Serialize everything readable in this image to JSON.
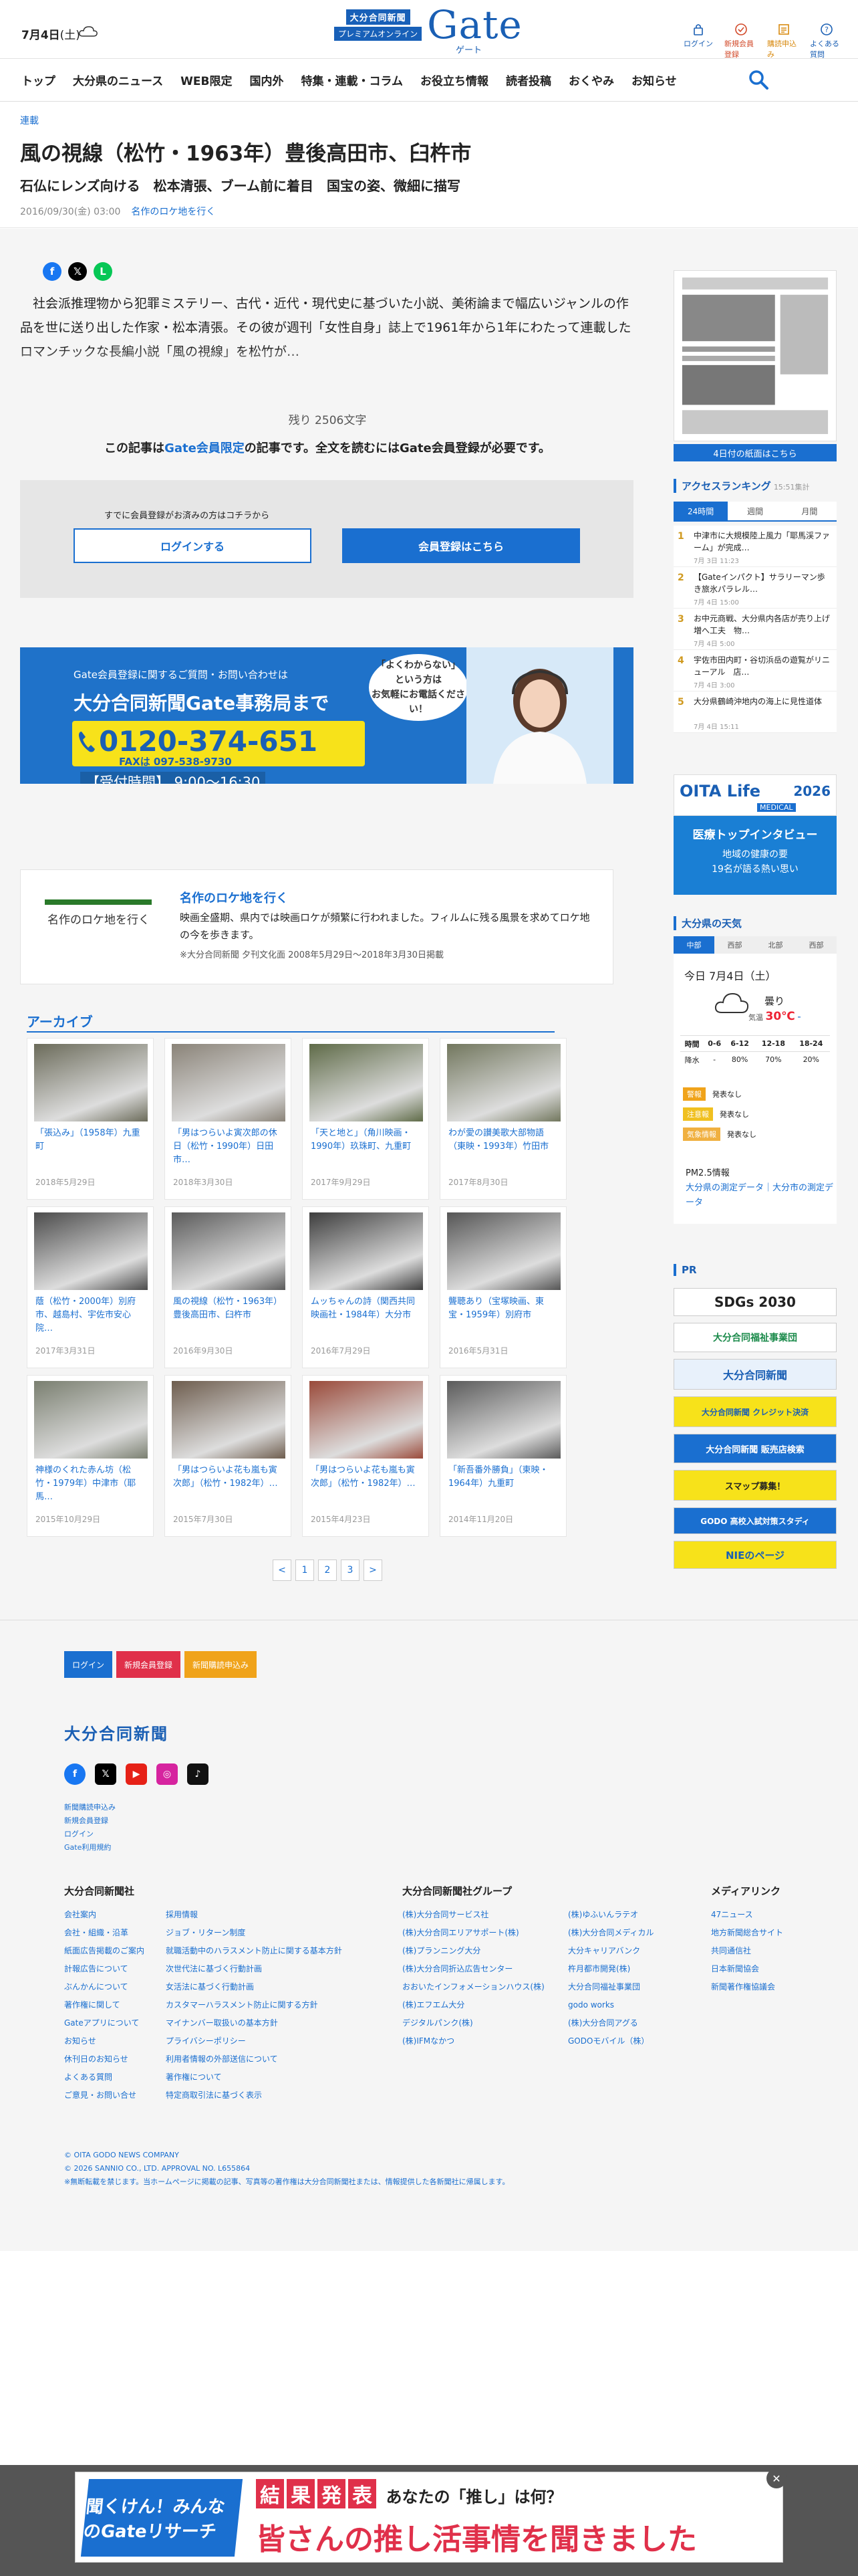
{
  "header": {
    "date": "7月4日",
    "weekday": "(土)",
    "logo_line1": "大分合同新聞",
    "logo_line2": "プレミアムオンライン",
    "logo_gate": "Gate",
    "logo_sub": "ゲート",
    "icons": [
      {
        "label": "ログイン",
        "icon": "login-icon"
      },
      {
        "label": "新規会員登録",
        "icon": "register-icon"
      },
      {
        "label": "購読申込み",
        "icon": "subscribe-icon"
      },
      {
        "label": "よくある質問",
        "icon": "faq-icon"
      }
    ]
  },
  "nav": {
    "items": [
      "トップ",
      "大分県のニュース",
      "WEB限定",
      "国内外",
      "特集・連載・コラム",
      "お役立ち情報",
      "読者投稿",
      "おくやみ",
      "お知らせ"
    ]
  },
  "article": {
    "category": "連載",
    "title": "風の視線（松竹・1963年）豊後高田市、臼杵市",
    "subtitle": "石仏にレンズ向ける　松本清張、ブーム前に着目　国宝の姿、微細に描写",
    "date": "2016/09/30(金) 03:00",
    "series_link": "名作のロケ地を行く",
    "body": "社会派推理物から犯罪ミステリー、古代・近代・現代史に基づいた小説、美術論まで幅広いジャンルの作品を世に送り出した作家・松本清張。その彼が週刊「女性自身」誌上で1961年から1年にわたって連載したロマンチックな長編小説「風の視線」を松竹が…",
    "remaining": "残り 2506文字",
    "notice_pre": "この記事は",
    "notice_link": "Gate会員限定",
    "notice_post": "の記事です。全文を読むにはGate会員登録が必要です。",
    "login_hint": "すでに会員登録がお済みの方はコチラから",
    "login_btn": "ログインする",
    "register_btn": "会員登録はこちら"
  },
  "banner": {
    "line1": "Gate会員登録に関するご質問・お問い合わせは",
    "line2": "大分合同新聞Gate事務局まで",
    "phone": "0120-374-651",
    "fax": "FAXは 097-538-9730",
    "hours": "【受付時間】 9:00～16:30",
    "bubble": "「よくわからない」\nという方は\nお気軽にお電話ください！"
  },
  "location_card": {
    "image_text": "名作のロケ地を行く",
    "title": "名作のロケ地を行く",
    "desc": "映画全盛期、県内では映画ロケが頻繁に行われました。フィルムに残る風景を求めてロケ地の今を歩きます。",
    "note": "※大分合同新聞 夕刊文化面 2008年5月29日～2018年3月30日掲載"
  },
  "archive": {
    "heading": "アーカイブ",
    "items": [
      {
        "title": "「張込み」（1958年）九重町",
        "date": "2018年5月29日"
      },
      {
        "title": "「男はつらいよ寅次郎の休日（松竹・1990年）日田市…",
        "date": "2018年3月30日"
      },
      {
        "title": "「天と地と」（角川映画・1990年）玖珠町、九重町",
        "date": "2017年9月29日"
      },
      {
        "title": "わが愛の讃美歌大部物語（東映・1993年）竹田市",
        "date": "2017年8月30日"
      },
      {
        "title": "蔭（松竹・2000年）別府市、越島村、宇佐市安心院…",
        "date": "2017年3月31日"
      },
      {
        "title": "風の視線（松竹・1963年）豊後高田市、臼杵市",
        "date": "2016年9月30日"
      },
      {
        "title": "ムッちゃんの詩（関西共同映画社・1984年）大分市",
        "date": "2016年7月29日"
      },
      {
        "title": "聾聴あり（宝塚映画、東宝・1959年）別府市",
        "date": "2016年5月31日"
      },
      {
        "title": "神様のくれた赤ん坊（松竹・1979年）中津市（耶馬…",
        "date": "2015年10月29日"
      },
      {
        "title": "「男はつらいよ花も嵐も寅次郎」（松竹・1982年）…",
        "date": "2015年7月30日"
      },
      {
        "title": "「男はつらいよ花も嵐も寅次郎」（松竹・1982年）…",
        "date": "2015年4月23日"
      },
      {
        "title": "「新吾番外勝負」（東映・1964年）九重町",
        "date": "2014年11月20日"
      }
    ],
    "pager": [
      "<",
      "1",
      "2",
      "3",
      ">"
    ]
  },
  "sidebar": {
    "paper_btn": "4日付の紙面はこちら",
    "ranking_head": "アクセスランキング",
    "ranking_time": "15:51集計",
    "ranking_tabs": [
      "24時間",
      "週間",
      "月間"
    ],
    "ranking": [
      {
        "n": "1",
        "title": "中津市に大規模陸上風力「耶馬渓ファーム」が完成…",
        "date": "7月 3日 11:23"
      },
      {
        "n": "2",
        "title": "【Gateインパクト】サラリーマン歩き旅氷パラレル…",
        "date": "7月 4日 15:00"
      },
      {
        "n": "3",
        "title": "お中元商戦、大分県内各店が売り上げ増へ工夫　物…",
        "date": "7月 4日 5:00"
      },
      {
        "n": "4",
        "title": "宇佐市田内町・谷切浜岳の遊覧がリニューアル　店…",
        "date": "7月 4日 3:00"
      },
      {
        "n": "5",
        "title": "大分県鶴崎沖地内の海上に見性道体",
        "date": "7月 4日 15:11"
      }
    ],
    "oita_life": {
      "title": "OITA Life",
      "year": "2026",
      "badge": "MEDICAL",
      "h1": "医療トップインタビュー",
      "h2": "地域の健康の要\n19名が語る熱い思い"
    },
    "weather": {
      "head": "大分県の天気",
      "tabs": [
        "中部",
        "西部",
        "北部",
        "西部"
      ],
      "day": "今日 7月4日（土）",
      "desc": "曇り",
      "temp_label": "気温",
      "temp_max": "30℃",
      "temp_min": "-",
      "table": {
        "head": [
          "時間",
          "0-6",
          "6-12",
          "12-18",
          "18-24"
        ],
        "rain": [
          "降水",
          "-",
          "80%",
          "70%",
          "20%"
        ]
      },
      "warnings": [
        {
          "tag": "警報",
          "text": "発表なし"
        },
        {
          "tag": "注意報",
          "text": "発表なし"
        },
        {
          "tag": "気象情報",
          "text": "発表なし"
        }
      ],
      "pm_head": "PM2.5情報",
      "pm_text": "大分県の測定データ｜大分市の測定データ"
    },
    "pr_head": "PR",
    "pr": [
      "SDGs 2030",
      "大分合同福祉事業団",
      "大分合同新聞",
      "大分合同新聞 クレジット決済",
      "大分合同新聞 販売店検索",
      "スマップ募集！",
      "GODO 高校入試対策スタディ",
      "NIEのページ"
    ]
  },
  "footer": {
    "btns": [
      "ログイン",
      "新規会員登録",
      "新聞購読申込み"
    ],
    "logo": "大分合同新聞",
    "links": [
      "新聞購読申込み",
      "新規会員登録",
      "ログイン",
      "Gate利用規約"
    ],
    "col1_head": "大分合同新聞社",
    "col1a": [
      "会社案内",
      "会社・組織・沿革",
      "紙面広告掲載のご案内",
      "計報広告について",
      "ぶんかんについて",
      "著作権に関して",
      "Gateアプリについて",
      "お知らせ",
      "休刊日のお知らせ",
      "よくある質問",
      "ご意見・お問い合せ"
    ],
    "col1b": [
      "採用情報",
      "ジョブ・リターン制度",
      "就職活動中のハラスメント防止に関する基本方針",
      "次世代法に基づく行動計画",
      "女活法に基づく行動計画",
      "カスタマーハラスメント防止に関する方針",
      "マイナンバー取扱いの基本方針",
      "プライバシーポリシー",
      "利用者情報の外部送信について",
      "著作権について",
      "特定商取引法に基づく表示"
    ],
    "col2_head": "大分合同新聞社グループ",
    "col2a": [
      "(株)大分合同サービス社",
      "(株)大分合同エリアサポート(株)",
      "(株)プランニング大分",
      "(株)大分合同折込広告センター",
      "おおいたインフォメーションハウス(株)",
      "(株)エフエム大分",
      "デジタルパンク(株)",
      "(株)IFMなかつ"
    ],
    "col2b": [
      "(株)ゆふいんラテオ",
      "(株)大分合同メディカル",
      "大分キャリアバンク",
      "杵月都市開発(株)",
      "大分合同福祉事業団",
      "godo works",
      "(株)大分合同アグる",
      "GODOモバイル（株）"
    ],
    "col3_head": "メディアリンク",
    "col3": [
      "47ニュース",
      "地方新聞総合サイト",
      "共同通信社",
      "日本新聞協会",
      "新聞著作権協議会"
    ],
    "copy": [
      "© OITA GODO NEWS COMPANY",
      "© 2026 SANNIO CO., LTD. APPROVAL NO. L655864",
      "※無断転載を禁じます。当ホームページに掲載の記事、写真等の著作権は大分合同新聞社または、情報提供した各新聞社に帰属します。"
    ]
  },
  "bottom_ad": {
    "left": "聞くけん！みんなのGateリサーチ",
    "kekka": [
      "結",
      "果",
      "発",
      "表"
    ],
    "q": "あなたの「推し」は何？",
    "main": "皆さんの推し活事情を聞きました",
    "close": "✕"
  }
}
